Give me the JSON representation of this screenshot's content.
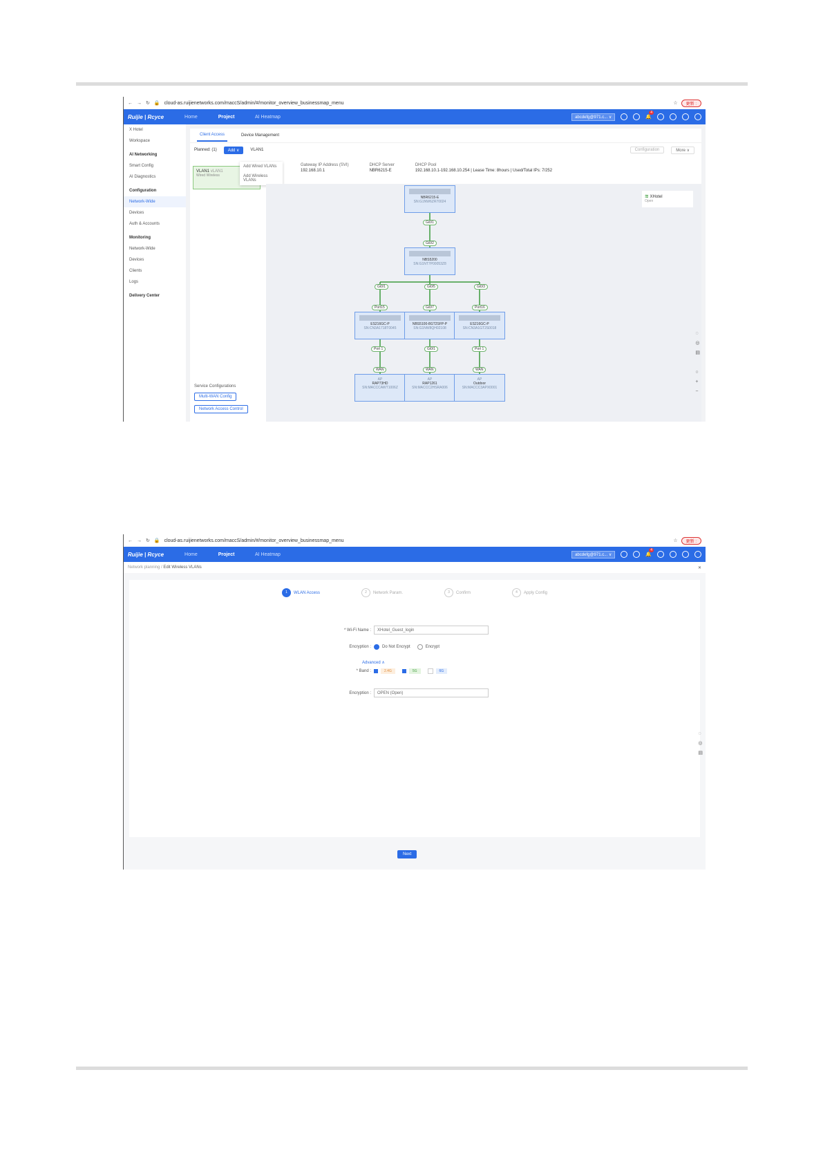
{
  "browser": {
    "url": "cloud-as.ruijienetworks.com/maccS/admin/#/monitor_overview_businessmap_menu",
    "ext_pill": "更新 :"
  },
  "topbar": {
    "logo": "Ruijie | Rcyce",
    "nav": [
      "Home",
      "Project",
      "AI Heatmap"
    ],
    "account": "abcdefg@971.c... ∨",
    "notif_badge": "4"
  },
  "shot1": {
    "sidebar": {
      "project": "X Hotel",
      "items": [
        {
          "label": "Workspace",
          "type": "item"
        },
        {
          "label": "AI Networking",
          "type": "sec"
        },
        {
          "label": "Smart Config",
          "type": "item"
        },
        {
          "label": "AI Diagnostics",
          "type": "item"
        },
        {
          "label": "Configuration",
          "type": "sec"
        },
        {
          "label": "Network-Wide",
          "type": "act"
        },
        {
          "label": "Devices",
          "type": "item"
        },
        {
          "label": "Auth & Accounts",
          "type": "item"
        },
        {
          "label": "Monitoring",
          "type": "sec"
        },
        {
          "label": "Network-Wide",
          "type": "item"
        },
        {
          "label": "Devices",
          "type": "item"
        },
        {
          "label": "Clients",
          "type": "item"
        },
        {
          "label": "Logs",
          "type": "item"
        },
        {
          "label": "Delivery Center",
          "type": "sec"
        }
      ]
    },
    "tabs": [
      "Client Access",
      "Device Management"
    ],
    "planned": "Planned:  (1)",
    "add_btn": "Add ∨",
    "vlan_title": "VLAN1",
    "config_btn": "Configuration",
    "more_btn": "More ∨",
    "vlan_card": {
      "name": "VLAN1",
      "sub": "vLAN1",
      "tag1": "Wired",
      "tag2": "Wireless"
    },
    "add_menu": [
      "Add Wired VLANs",
      "Add Wireless VLANs"
    ],
    "gateway": {
      "label": "Gateway IP Address (SVI)",
      "value": "192.168.10.1"
    },
    "dhcp_server": {
      "label": "DHCP Server",
      "value": "NBR6215-E"
    },
    "dhcp_pool": {
      "label": "DHCP Pool",
      "value": "192.168.10.1-192.168.10.254  |  Lease Time:  8hours  |  Used/Total IPs:  7/252"
    },
    "ssid": {
      "name": "XHotel",
      "state": "Open"
    },
    "service_title": "Service Configurations",
    "service_buttons": [
      "Multi-WAN Config",
      "Network Access Control"
    ],
    "nodes": [
      {
        "name": "NBR6215-E",
        "sn": "SN:G1NW6ZR70024"
      },
      {
        "name": "NBS5200",
        "sn": "SN:G1NT7P00053Z8"
      },
      {
        "name": "ES216GC-P",
        "sn": "SN:CN3A1718T0045"
      },
      {
        "name": "NBS5100-8GT2SFP-P",
        "sn": "SN:G1NW8QH02108"
      },
      {
        "name": "ES216GC-P",
        "sn": "SN:CN3A1GT2S0018"
      },
      {
        "name": "RAP73HD",
        "sn": "SN:MACCCAWT1006Z"
      },
      {
        "name": "RAP1261",
        "sn": "SN:MACCC2HSRA006"
      },
      {
        "name": "Outdoor",
        "sn": "SN:MACCC3APX0001"
      }
    ],
    "ap_label": "AP",
    "ports": [
      "Gi0/1",
      "Gi0/2",
      "Gi0/1",
      "Gi0/5",
      "Gi0/3",
      "Port15",
      "Gi0/7",
      "Port16",
      "Port 1",
      "Gi0/1",
      "Port 1",
      "WAN",
      "WAN",
      "WAN"
    ]
  },
  "shot2": {
    "breadcrumb": [
      "Network planning",
      "Edit Wireless VLANs"
    ],
    "steps": [
      {
        "n": "1",
        "label": "WLAN Access"
      },
      {
        "n": "2",
        "label": "Network Param."
      },
      {
        "n": "3",
        "label": "Confirm"
      },
      {
        "n": "4",
        "label": "Apply Config"
      }
    ],
    "wifi_name_label": "* Wi-Fi Name :",
    "wifi_name_value": "XHotel_Guest_login",
    "enc_label": "Encryption :",
    "enc_opt1": "Do Not Encrypt",
    "enc_opt2": "Encrypt",
    "advanced": "Advanced ∧",
    "band_label": "* Band :",
    "bands": [
      "2.4G",
      "5G",
      "6G"
    ],
    "enc2_label": "Encryption :",
    "enc2_value": "OPEN (Open)",
    "next_btn": "Next"
  }
}
